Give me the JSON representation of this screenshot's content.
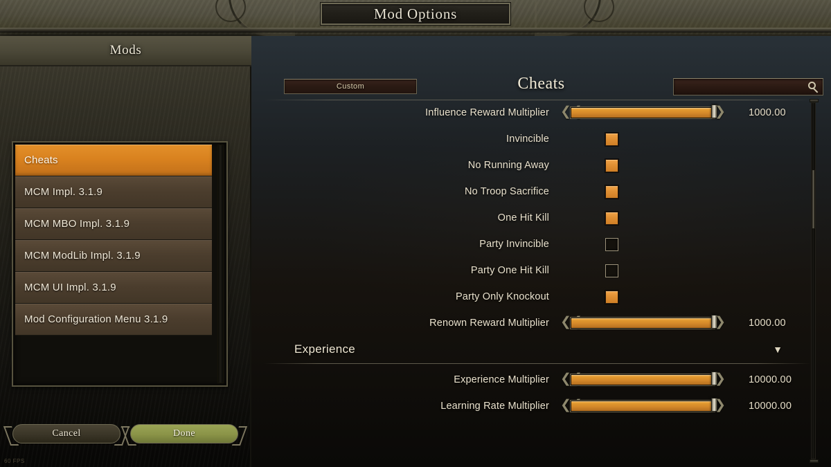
{
  "window": {
    "title": "Mod Options"
  },
  "sidebar": {
    "header": "Mods",
    "items": [
      {
        "label": "Cheats",
        "selected": true
      },
      {
        "label": "MCM Impl. 3.1.9",
        "selected": false
      },
      {
        "label": "MCM MBO Impl. 3.1.9",
        "selected": false
      },
      {
        "label": "MCM ModLib Impl. 3.1.9",
        "selected": false
      },
      {
        "label": "MCM UI Impl. 3.1.9",
        "selected": false
      },
      {
        "label": "Mod Configuration Menu 3.1.9",
        "selected": false
      }
    ],
    "cancel_label": "Cancel",
    "done_label": "Done"
  },
  "hud": {
    "fps": "60 FPS"
  },
  "main": {
    "preset_label": "Custom",
    "title": "Cheats",
    "search": {
      "value": "",
      "placeholder": ""
    },
    "rows": [
      {
        "kind": "slider",
        "label": "Influence Reward Multiplier",
        "value": "1000.00",
        "percent": 100
      },
      {
        "kind": "checkbox",
        "label": "Invincible",
        "checked": true
      },
      {
        "kind": "checkbox",
        "label": "No Running Away",
        "checked": true
      },
      {
        "kind": "checkbox",
        "label": "No Troop Sacrifice",
        "checked": true
      },
      {
        "kind": "checkbox",
        "label": "One Hit Kill",
        "checked": true
      },
      {
        "kind": "checkbox",
        "label": "Party Invincible",
        "checked": false
      },
      {
        "kind": "checkbox",
        "label": "Party One Hit Kill",
        "checked": false
      },
      {
        "kind": "checkbox",
        "label": "Party Only Knockout",
        "checked": true
      },
      {
        "kind": "slider",
        "label": "Renown Reward Multiplier",
        "value": "1000.00",
        "percent": 100
      },
      {
        "kind": "section",
        "label": "Experience",
        "caret": "▼"
      },
      {
        "kind": "slider",
        "label": "Experience Multiplier",
        "value": "10000.00",
        "percent": 100
      },
      {
        "kind": "slider",
        "label": "Learning Rate Multiplier",
        "value": "10000.00",
        "percent": 100
      }
    ]
  },
  "colors": {
    "accent_orange": "#e0902a",
    "slider_fill": "#d9902e",
    "done_green": "#8a9347",
    "text": "#eae2cd"
  }
}
